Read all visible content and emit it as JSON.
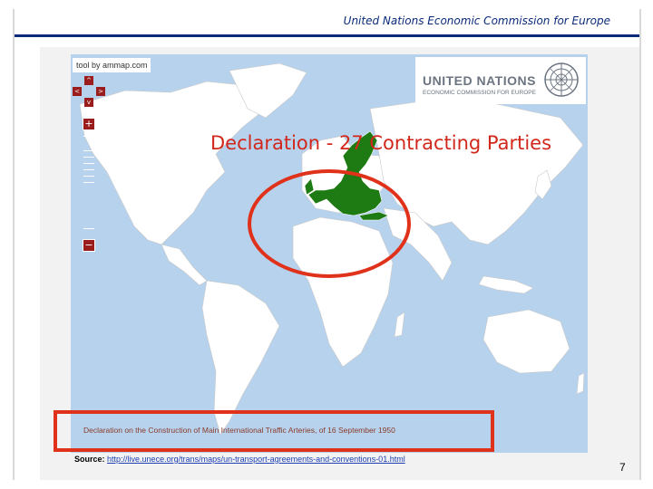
{
  "header": {
    "title": "United Nations Economic Commission for Europe"
  },
  "map": {
    "credit": "tool by ammap.com",
    "title": "Declaration - 27 Contracting Parties",
    "caption": "Declaration on the Construction of Main International Traffic Arteries, of 16 September 1950",
    "colors": {
      "ocean": "#b7d2ec",
      "land": "#ffffff",
      "contracting": "#1e7a12",
      "accent": "#d2271b"
    }
  },
  "nav": {
    "up": "^",
    "left": "<",
    "right": ">",
    "down": "v",
    "zoom_in": "+",
    "zoom_out": "−"
  },
  "logo": {
    "name": "UNITED NATIONS",
    "subtitle": "ECONOMIC COMMISSION FOR EUROPE"
  },
  "source": {
    "label": "Source:",
    "link": "http://live.unece.org/trans/maps/un-transport-agreements-and-conventions-01.html"
  },
  "page_number": "7"
}
